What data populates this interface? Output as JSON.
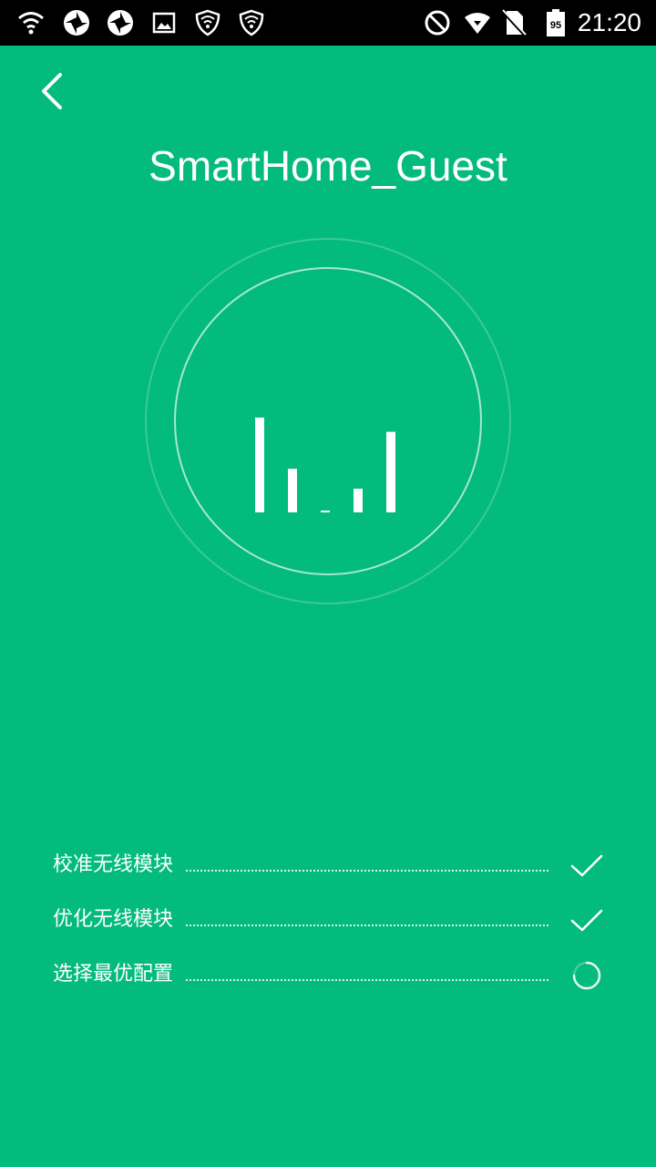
{
  "status_bar": {
    "time": "21:20",
    "battery_level": "95",
    "icons": [
      "wifi-icon",
      "vpn-icon",
      "vpn-icon",
      "image-icon",
      "shield-icon",
      "shield-icon",
      "do-not-disturb-icon",
      "wifi-signal-icon",
      "no-sim-icon",
      "battery-icon"
    ]
  },
  "header": {
    "back_icon": "chevron-left-icon",
    "title": "SmartHome_Guest"
  },
  "signal_meter": {
    "bar_levels": [
      1.0,
      0.46,
      0.0,
      0.25,
      0.85
    ]
  },
  "steps": [
    {
      "label": "校准无线模块",
      "status": "done"
    },
    {
      "label": "优化无线模块",
      "status": "done"
    },
    {
      "label": "选择最优配置",
      "status": "in-progress"
    }
  ],
  "colors": {
    "background": "#03bb7d",
    "status_bar": "#000000",
    "foreground": "#ffffff"
  }
}
